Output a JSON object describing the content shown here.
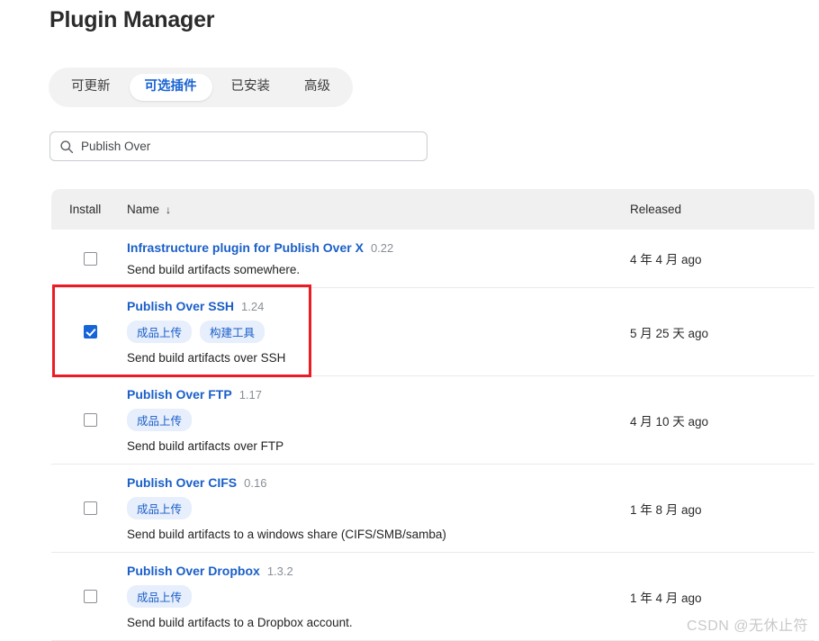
{
  "page": {
    "title": "Plugin Manager"
  },
  "tabs": [
    {
      "label": "可更新",
      "active": false
    },
    {
      "label": "可选插件",
      "active": true
    },
    {
      "label": "已安装",
      "active": false
    },
    {
      "label": "高级",
      "active": false
    }
  ],
  "search": {
    "value": "Publish Over",
    "placeholder": "",
    "icon": "search-icon"
  },
  "table": {
    "headers": {
      "install": "Install",
      "name": "Name",
      "sort_indicator": "↓",
      "released": "Released"
    },
    "rows": [
      {
        "checked": false,
        "name": "Infrastructure plugin for Publish Over X",
        "version": "0.22",
        "labels": [],
        "description": "Send build artifacts somewhere.",
        "released": "4 年 4 月 ago",
        "highlighted": false
      },
      {
        "checked": true,
        "name": "Publish Over SSH",
        "version": "1.24",
        "labels": [
          "成品上传",
          "构建工具"
        ],
        "description": "Send build artifacts over SSH",
        "released": "5 月 25 天 ago",
        "highlighted": true
      },
      {
        "checked": false,
        "name": "Publish Over FTP",
        "version": "1.17",
        "labels": [
          "成品上传"
        ],
        "description": "Send build artifacts over FTP",
        "released": "4 月 10 天 ago",
        "highlighted": false
      },
      {
        "checked": false,
        "name": "Publish Over CIFS",
        "version": "0.16",
        "labels": [
          "成品上传"
        ],
        "description": "Send build artifacts to a windows share (CIFS/SMB/samba)",
        "released": "1 年 8 月 ago",
        "highlighted": false
      },
      {
        "checked": false,
        "name": "Publish Over Dropbox",
        "version": "1.3.2",
        "labels": [
          "成品上传"
        ],
        "description": "Send build artifacts to a Dropbox account.",
        "released": "1 年 4 月 ago",
        "highlighted": false
      }
    ]
  },
  "watermark": "CSDN @无休止符",
  "colors": {
    "link": "#1a5fc8",
    "active_tab_text": "#1a64d4",
    "checkbox_checked": "#1565d8",
    "label_bg": "#e7eefc",
    "highlight_border": "#ec1c24",
    "header_bg": "#f0f0f0",
    "tabs_bg": "#f2f2f2"
  }
}
